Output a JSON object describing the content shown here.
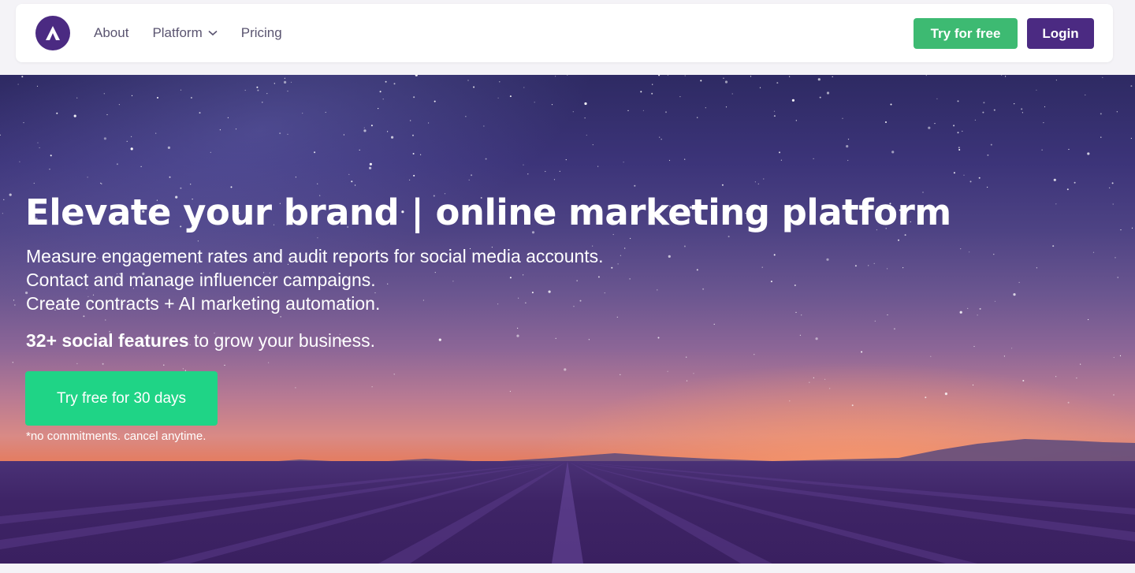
{
  "header": {
    "logo_icon": "brand-logo-icon",
    "nav": [
      {
        "label": "About"
      },
      {
        "label": "Platform",
        "icon": "chevron-down-icon"
      },
      {
        "label": "Pricing"
      }
    ],
    "try_label": "Try for free",
    "login_label": "Login"
  },
  "hero": {
    "title": "Elevate your brand | online marketing platform",
    "lines": [
      "Measure engagement rates and audit reports for social media accounts.",
      "Contact and manage influencer campaigns.",
      "Create contracts + AI marketing automation."
    ],
    "feature_bold": "32+ social features",
    "feature_rest": " to grow your business.",
    "cta_label": "Try free for 30 days",
    "note": "*no commitments. cancel anytime."
  },
  "colors": {
    "brand_purple": "#4b2a82",
    "green_button": "#3dba72",
    "hero_cta": "#1fd486"
  }
}
